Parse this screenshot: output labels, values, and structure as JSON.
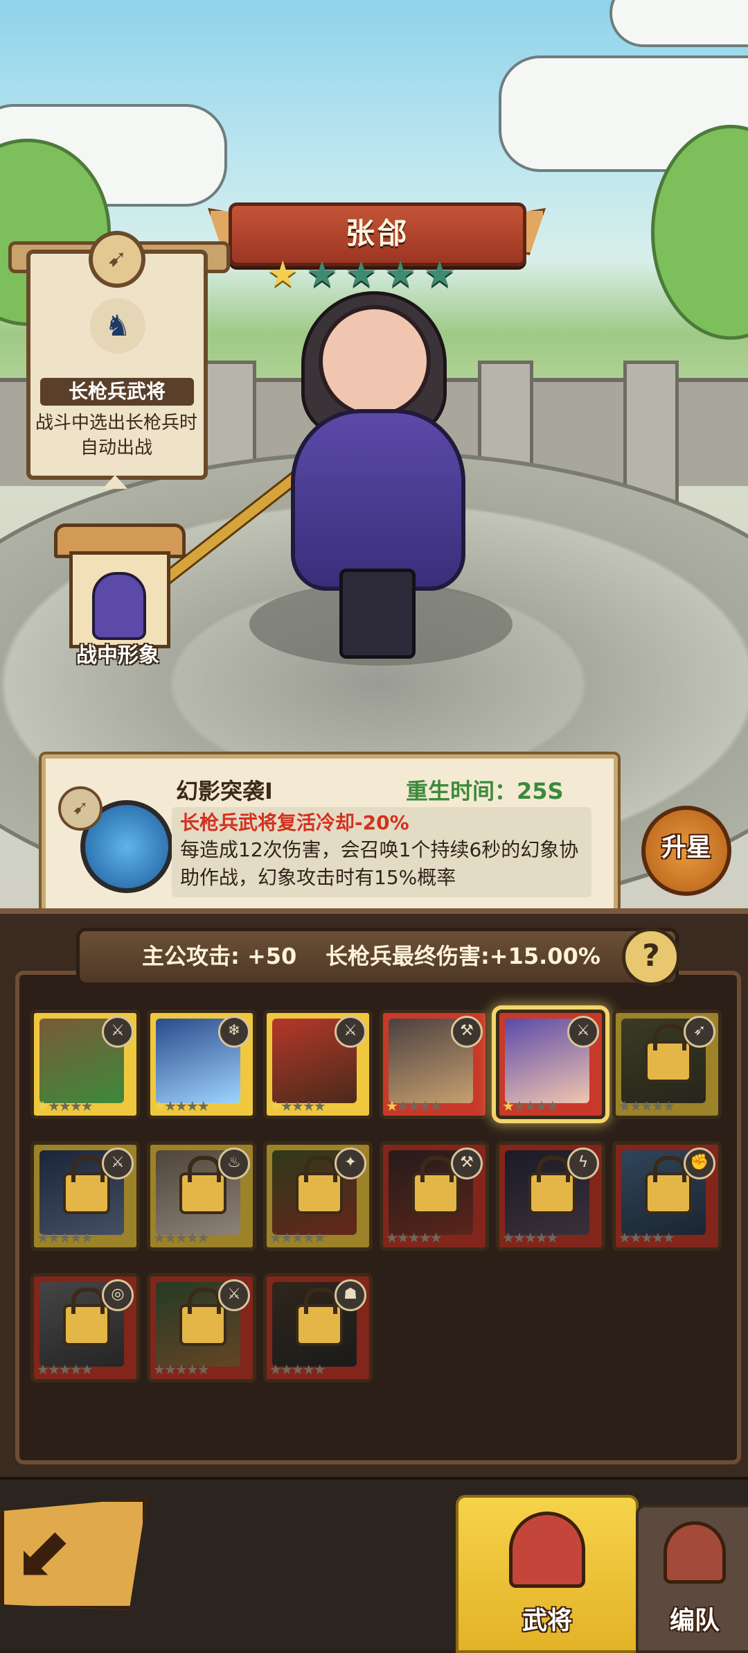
{
  "hero": {
    "name": "张郃",
    "stars_filled": 1,
    "stars_total": 5
  },
  "role_scroll": {
    "title": "长枪兵武将",
    "description": "战斗中选出长枪兵时自动出战"
  },
  "battle_image": {
    "label": "战中形象"
  },
  "skill": {
    "name": "幻影突袭Ⅰ",
    "respawn": "重生时间：25S",
    "highlight": "长枪兵武将复活冷却-20%",
    "description": "每造成12次伤害，会召唤1个持续6秒的幻象协助作战，幻象攻击时有15%概率"
  },
  "upgrade_label": "升星",
  "stats": {
    "lord_attack": "主公攻击: +50",
    "spear_damage": "长枪兵最终伤害:+15.00%",
    "help": "?"
  },
  "cards": [
    {
      "icon": "sword-icon",
      "glyph": "⚔",
      "tier": "gold",
      "locked": false,
      "stars": 1,
      "colors": [
        "#7a5a3a",
        "#3d8a3a"
      ]
    },
    {
      "icon": "frost-icon",
      "glyph": "❄",
      "tier": "gold",
      "locked": false,
      "stars": 1,
      "colors": [
        "#2a4a8a",
        "#9fd4ff"
      ]
    },
    {
      "icon": "blade-icon",
      "glyph": "⚔",
      "tier": "gold",
      "locked": false,
      "stars": 1,
      "colors": [
        "#b5382a",
        "#4a2a1a"
      ]
    },
    {
      "icon": "axe-icon",
      "glyph": "⚒",
      "tier": "red",
      "locked": false,
      "stars": 1,
      "colors": [
        "#4a4040",
        "#c8a070"
      ]
    },
    {
      "icon": "spear-icon",
      "glyph": "⚔",
      "tier": "red",
      "locked": false,
      "stars": 1,
      "selected": true,
      "colors": [
        "#5b4aa8",
        "#f1c6b0"
      ]
    },
    {
      "icon": "bow-icon",
      "glyph": "➶",
      "tier": "gold",
      "locked": true,
      "stars": 0,
      "colors": [
        "#5a5a3a",
        "#3a3a2a"
      ]
    },
    {
      "icon": "sword-icon",
      "glyph": "⚔",
      "tier": "gold",
      "locked": true,
      "stars": 0,
      "colors": [
        "#2a3a5a",
        "#6a7a9a"
      ]
    },
    {
      "icon": "fire-icon",
      "glyph": "♨",
      "tier": "gold",
      "locked": true,
      "stars": 0,
      "colors": [
        "#7a6a5a",
        "#d8c8b8"
      ]
    },
    {
      "icon": "wind-icon",
      "glyph": "✦",
      "tier": "gold",
      "locked": true,
      "stars": 0,
      "colors": [
        "#4a5a2a",
        "#9a3a2a"
      ]
    },
    {
      "icon": "axe-icon",
      "glyph": "⚒",
      "tier": "red",
      "locked": true,
      "stars": 0,
      "colors": [
        "#3a2a2a",
        "#8a3a2a"
      ]
    },
    {
      "icon": "lightning-icon",
      "glyph": "ϟ",
      "tier": "red",
      "locked": true,
      "stars": 0,
      "colors": [
        "#2a2a3a",
        "#5a4a5a"
      ]
    },
    {
      "icon": "fist-icon",
      "glyph": "✊",
      "tier": "red",
      "locked": true,
      "stars": 0,
      "colors": [
        "#4a6a8a",
        "#2a3a4a"
      ]
    },
    {
      "icon": "swirl-icon",
      "glyph": "◎",
      "tier": "red",
      "locked": true,
      "stars": 0,
      "colors": [
        "#6a6a6a",
        "#3a3a3a"
      ]
    },
    {
      "icon": "crossed-swords-icon",
      "glyph": "⚔",
      "tier": "red",
      "locked": true,
      "stars": 0,
      "colors": [
        "#3a5a3a",
        "#9a6a3a"
      ]
    },
    {
      "icon": "beast-icon",
      "glyph": "☗",
      "tier": "red",
      "locked": true,
      "stars": 0,
      "colors": [
        "#4a3a2a",
        "#2a2a2a"
      ]
    }
  ],
  "tabs": {
    "generals": "武将",
    "team": "编队"
  }
}
